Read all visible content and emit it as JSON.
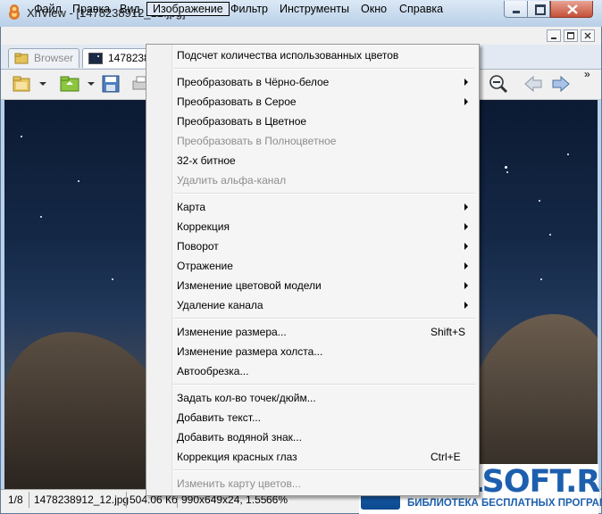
{
  "window": {
    "title": "XnView - [1478238912_12.jpg]"
  },
  "menubar": {
    "items": [
      "Файл",
      "Правка",
      "Вид",
      "Изображение",
      "Фильтр",
      "Инструменты",
      "Окно",
      "Справка"
    ]
  },
  "tabs": [
    {
      "label": "Browser"
    },
    {
      "label": "1478238"
    }
  ],
  "toolbar": {
    "overflow_label": "»"
  },
  "image_menu": {
    "items": [
      {
        "label": "Подсчет количества использованных цветов"
      },
      {
        "label": "Преобразовать в Чёрно-белое",
        "submenu": true
      },
      {
        "label": "Преобразовать в Серое",
        "submenu": true
      },
      {
        "label": "Преобразовать в Цветное"
      },
      {
        "label": "Преобразовать в Полноцветное",
        "disabled": true
      },
      {
        "label": "32-х битное"
      },
      {
        "label": "Удалить альфа-канал",
        "disabled": true
      },
      {
        "label": "Карта",
        "submenu": true
      },
      {
        "label": "Коррекция",
        "submenu": true
      },
      {
        "label": "Поворот",
        "submenu": true
      },
      {
        "label": "Отражение",
        "submenu": true
      },
      {
        "label": "Изменение цветовой модели",
        "submenu": true
      },
      {
        "label": "Удаление канала",
        "submenu": true
      },
      {
        "label": "Изменение размера...",
        "shortcut": "Shift+S"
      },
      {
        "label": "Изменение размера холста..."
      },
      {
        "label": "Автообрезка..."
      },
      {
        "label": "Задать кол-во точек/дюйм..."
      },
      {
        "label": "Добавить текст..."
      },
      {
        "label": "Добавить водяной знак..."
      },
      {
        "label": "Коррекция красных глаз",
        "shortcut": "Ctrl+E"
      },
      {
        "label": "Изменить карту цветов...",
        "disabled": true
      }
    ]
  },
  "statusbar": {
    "position": "1/8",
    "filename": "1478238912_12.jpg",
    "filesize": "504.06 Кб",
    "dimensions": "990x649x24, 1.55",
    "zoom": "66%"
  },
  "watermark": {
    "title": "BIBLSOFT.RU",
    "subtitle": "БИБЛИОТЕКА БЕСПЛАТНЫХ ПРОГРАММ"
  },
  "colors": {
    "menu_highlight_border": "#000000",
    "disabled_text": "#8d8d8d",
    "watermark_blue": "#1d5fae"
  }
}
